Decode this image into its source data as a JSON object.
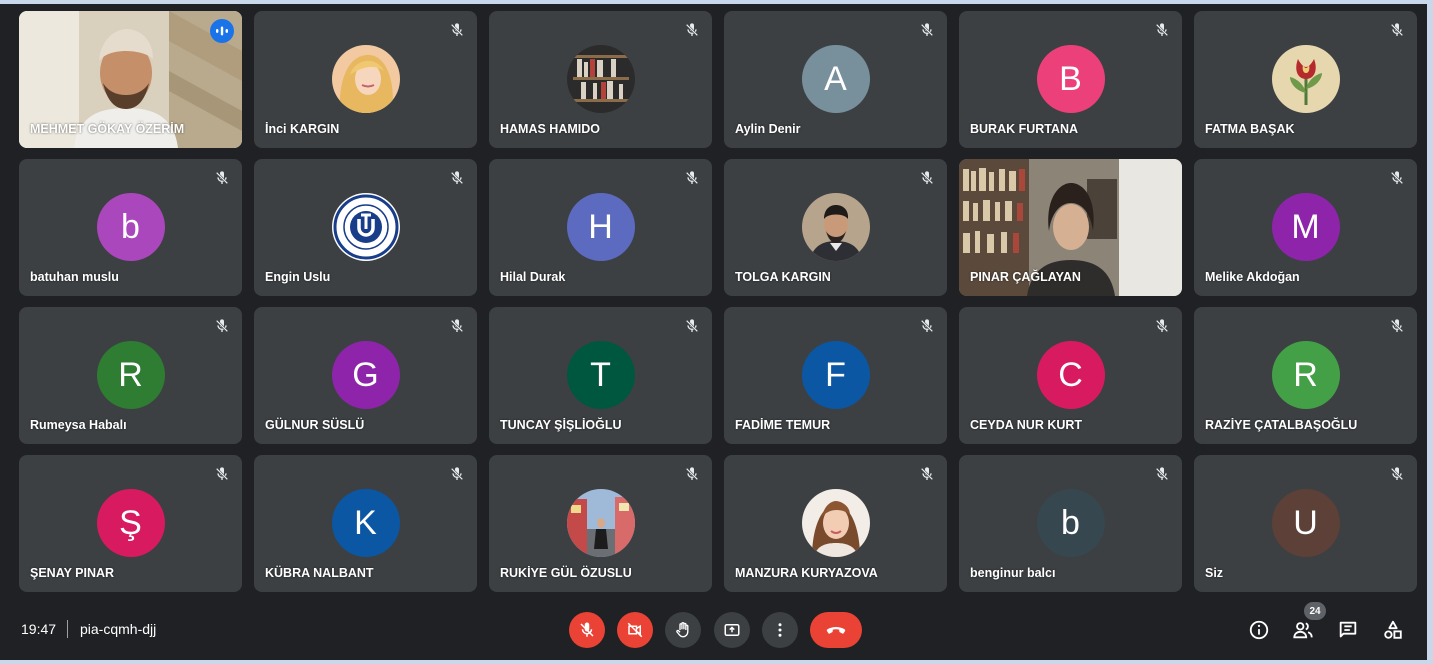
{
  "participants": [
    {
      "name": "MEHMET GÖKAY ÖZERİM",
      "type": "video",
      "speaking": true
    },
    {
      "name": "İnci KARGIN",
      "type": "photo",
      "photo": "blonde-woman"
    },
    {
      "name": "HAMAS HAMIDO",
      "type": "photo",
      "photo": "bookshelf"
    },
    {
      "name": "Aylin Denir",
      "type": "initial",
      "initial": "A",
      "color": "#78909c"
    },
    {
      "name": "BURAK FURTANA",
      "type": "initial",
      "initial": "B",
      "color": "#ec407a"
    },
    {
      "name": "FATMA BAŞAK",
      "type": "photo",
      "photo": "tulip-art"
    },
    {
      "name": "batuhan muslu",
      "type": "initial",
      "initial": "b",
      "color": "#ab47bc"
    },
    {
      "name": "Engin Uslu",
      "type": "photo",
      "photo": "university-logo"
    },
    {
      "name": "Hilal Durak",
      "type": "initial",
      "initial": "H",
      "color": "#5c6bc0"
    },
    {
      "name": "TOLGA KARGIN",
      "type": "photo",
      "photo": "man-portrait"
    },
    {
      "name": "PINAR ÇAĞLAYAN",
      "type": "video"
    },
    {
      "name": "Melike Akdoğan",
      "type": "initial",
      "initial": "M",
      "color": "#8e24aa"
    },
    {
      "name": "Rumeysa Habalı",
      "type": "initial",
      "initial": "R",
      "color": "#2e7d32"
    },
    {
      "name": "GÜLNUR SÜSLÜ",
      "type": "initial",
      "initial": "G",
      "color": "#8e24aa"
    },
    {
      "name": "TUNCAY ŞİŞLİOĞLU",
      "type": "initial",
      "initial": "T",
      "color": "#00573f"
    },
    {
      "name": "FADİME TEMUR",
      "type": "initial",
      "initial": "F",
      "color": "#0b57a4"
    },
    {
      "name": "CEYDA NUR KURT",
      "type": "initial",
      "initial": "C",
      "color": "#d81b60"
    },
    {
      "name": "RAZİYE ÇATALBAŞOĞLU",
      "type": "initial",
      "initial": "R",
      "color": "#43a047"
    },
    {
      "name": "ŞENAY PINAR",
      "type": "initial",
      "initial": "Ş",
      "color": "#d81b60"
    },
    {
      "name": "KÜBRA NALBANT",
      "type": "initial",
      "initial": "K",
      "color": "#0b57a4"
    },
    {
      "name": "RUKİYE GÜL ÖZUSLU",
      "type": "photo",
      "photo": "street-photo"
    },
    {
      "name": "MANZURA KURYAZOVA",
      "type": "photo",
      "photo": "woman-portrait"
    },
    {
      "name": "benginur balcı",
      "type": "initial",
      "initial": "b",
      "color": "#37474f"
    },
    {
      "name": "Siz",
      "type": "initial",
      "initial": "U",
      "color": "#5d4037"
    }
  ],
  "bottom_bar": {
    "time": "19:47",
    "meeting_code": "pia-cqmh-djj",
    "people_count": "24",
    "controls": [
      {
        "name": "mic-off-button",
        "icon": "mic-off-icon",
        "style": "red"
      },
      {
        "name": "camera-off-button",
        "icon": "camera-off-icon",
        "style": "red"
      },
      {
        "name": "raise-hand-button",
        "icon": "hand-icon",
        "style": "dark"
      },
      {
        "name": "present-screen-button",
        "icon": "present-icon",
        "style": "dark"
      },
      {
        "name": "more-options-button",
        "icon": "more-vert-icon",
        "style": "dark"
      },
      {
        "name": "leave-call-button",
        "icon": "phone-hangup-icon",
        "style": "end"
      }
    ],
    "right_icons": [
      "info-icon",
      "people-icon",
      "chat-icon",
      "activities-icon"
    ]
  },
  "colors": {
    "tile": "#3c4043",
    "background": "#202124",
    "accent": "#8ab4f8",
    "danger": "#ea4335"
  }
}
